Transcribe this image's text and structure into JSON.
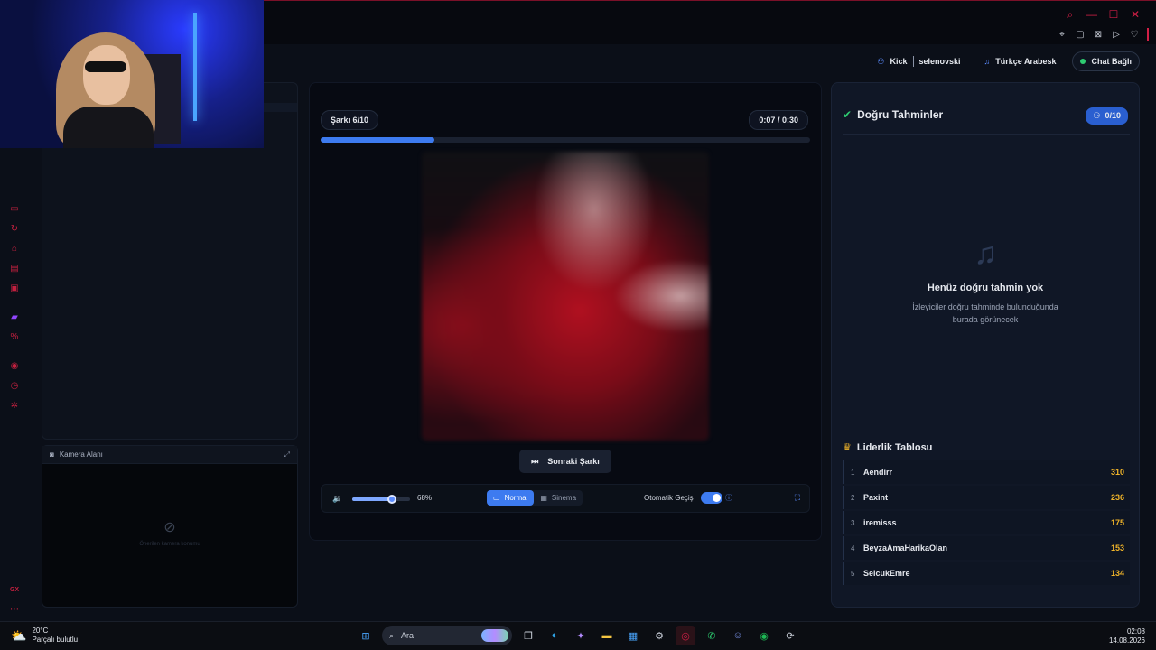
{
  "window": {
    "controls": [
      "⌕",
      "—",
      "☐",
      "✕"
    ],
    "toolbar": [
      "⌖",
      "▢",
      "⊠",
      "▷",
      "♡"
    ]
  },
  "status": {
    "platform": "Kick",
    "channel": "selenovski",
    "playlist": "Türkçe Arabesk",
    "chat": "Chat Bağlı"
  },
  "camera": {
    "title": "Kamera Alanı",
    "empty_text": "Önerilen kamera konumu"
  },
  "player": {
    "song_counter": "Şarkı 6/10",
    "elapsed": "0:07",
    "separator": "/",
    "duration": "0:30",
    "progress_fraction": 0.233,
    "next_label": "Sonraki Şarkı",
    "volume_fraction": 0.68,
    "volume_label": "68%",
    "modes": [
      {
        "label": "Normal",
        "active": true
      },
      {
        "label": "Sinema",
        "active": false
      }
    ],
    "auto_label": "Otomatik Geçiş",
    "auto_enabled": true
  },
  "guesses": {
    "title": "Doğru Tahminler",
    "count": "0/10",
    "empty_title": "Henüz doğru tahmin yok",
    "empty_text_line1": "İzleyiciler doğru tahminde bulunduğunda",
    "empty_text_line2": "burada görünecek"
  },
  "leaderboard": {
    "title": "Liderlik Tablosu",
    "rows": [
      {
        "rank": "1",
        "name": "Aendirr",
        "score": "310"
      },
      {
        "rank": "2",
        "name": "Paxint",
        "score": "236"
      },
      {
        "rank": "3",
        "name": "iremisss",
        "score": "175"
      },
      {
        "rank": "4",
        "name": "BeyzaAmaHarikaOlan",
        "score": "153"
      },
      {
        "rank": "5",
        "name": "SelcukEmre",
        "score": "134"
      }
    ]
  },
  "taskbar": {
    "temperature": "20°C",
    "weather": "Parçalı bulutlu",
    "search_placeholder": "Ara",
    "time": "02:08",
    "date": "14.08.2026"
  },
  "colors": {
    "accent": "#3d7bf0",
    "brand_red": "#d21f46",
    "score": "#f0b429",
    "online": "#2ecc71"
  },
  "sidebar_icons": [
    "gamepad-icon",
    "refresh-icon",
    "robot-icon",
    "monitor-icon",
    "grid-icon",
    "twitch-icon",
    "percent-icon",
    "play-circle-icon",
    "clock-icon",
    "settings-icon"
  ],
  "sidebar_bottom_label": "GX"
}
